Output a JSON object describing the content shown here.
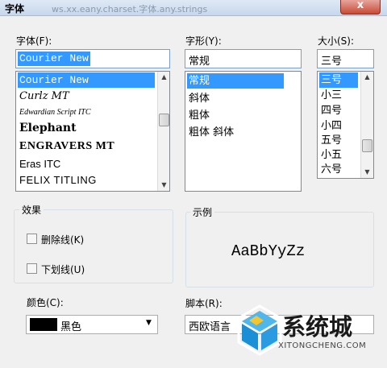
{
  "window": {
    "title": "字体",
    "blurred_title": "ws.xx.eany.charset.字体.any.strings",
    "close_glyph": "x"
  },
  "font": {
    "label": "字体(F):",
    "value": "Courier New",
    "items": [
      "Courier New",
      "Curlz MT",
      "Edwardian Script ITC",
      "Elephant",
      "ENGRAVERS MT",
      "Eras ITC",
      "FELIX TITLING"
    ],
    "selected": "Courier New"
  },
  "style": {
    "label": "字形(Y):",
    "value": "常规",
    "items": [
      "常规",
      "斜体",
      "粗体",
      "粗体 斜体"
    ],
    "selected": "常规"
  },
  "size": {
    "label": "大小(S):",
    "value": "三号",
    "items": [
      "三号",
      "小三",
      "四号",
      "小四",
      "五号",
      "小五",
      "六号"
    ],
    "selected": "三号"
  },
  "effects": {
    "label": "效果",
    "strikethrough_label": "删除线(K)",
    "strikethrough_checked": false,
    "underline_label": "下划线(U)",
    "underline_checked": false
  },
  "color": {
    "label": "颜色(C):",
    "value": "黑色",
    "swatch": "#000000"
  },
  "preview": {
    "label": "示例",
    "text": "AaBbYyZz"
  },
  "script": {
    "label": "脚本(R):",
    "value": "西欧语言"
  },
  "watermark": {
    "text": "系统城",
    "url": "XITONGCHENG.COM"
  },
  "icons": [
    "close-icon",
    "dropdown-arrow-icon",
    "scroll-up-icon",
    "scroll-down-icon",
    "watermark-logo-icon"
  ]
}
